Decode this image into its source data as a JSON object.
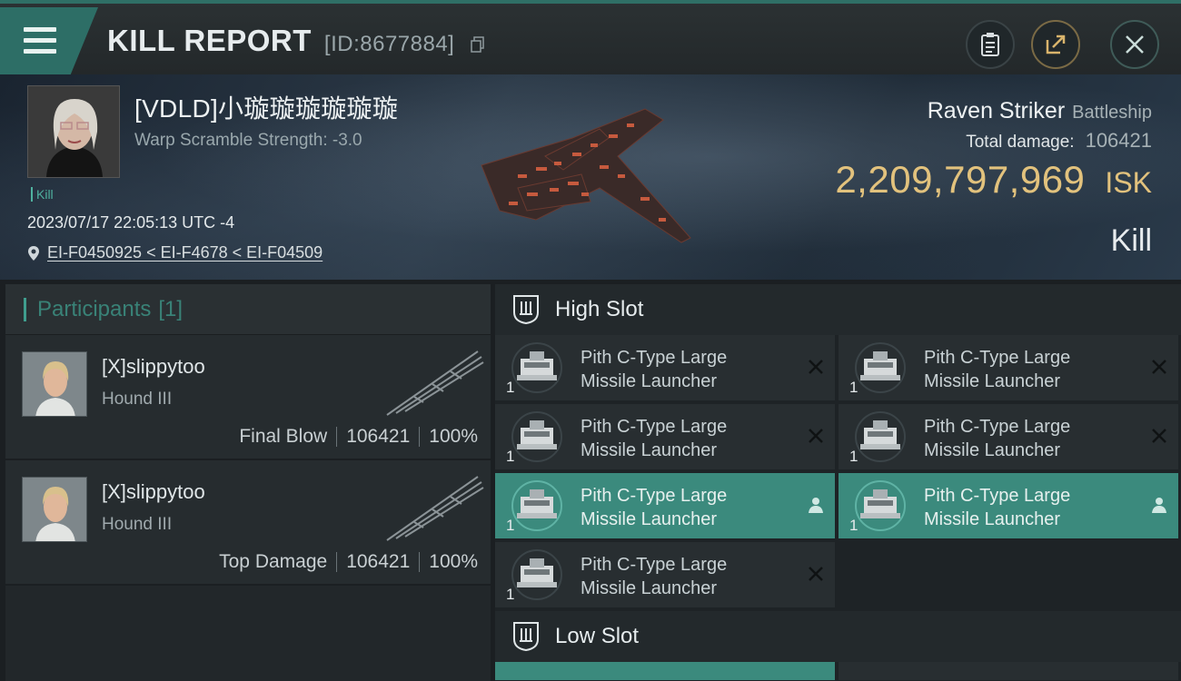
{
  "header": {
    "title": "KILL REPORT",
    "report_id": "[ID:8677884]"
  },
  "victim": {
    "name": "[VDLD]小璇璇璇璇璇璇",
    "warp_scramble": "Warp Scramble Strength: -3.0",
    "tag": "Kill",
    "datetime": "2023/07/17 22:05:13 UTC -4",
    "location": "EI-F0450925 < EI-F4678 < EI-F04509",
    "ship_name": "Raven Striker",
    "ship_class": "Battleship",
    "total_damage_label": "Total damage:",
    "total_damage": "106421",
    "isk_value": "2,209,797,969",
    "isk_unit": "ISK",
    "result": "Kill"
  },
  "participants": {
    "title": "Participants",
    "count": "[1]",
    "rows": [
      {
        "name": "[X]slippytoo",
        "ship": "Hound III",
        "label": "Final Blow",
        "damage": "106421",
        "percent": "100%"
      },
      {
        "name": "[X]slippytoo",
        "ship": "Hound III",
        "label": "Top Damage",
        "damage": "106421",
        "percent": "100%"
      }
    ]
  },
  "slots": {
    "high_title": "High Slot",
    "low_title": "Low Slot",
    "high": [
      {
        "line1": "Pith C-Type Large",
        "line2": "Missile Launcher",
        "qty": "1",
        "state": "destroyed",
        "active": false
      },
      {
        "line1": "Pith C-Type Large",
        "line2": "Missile Launcher",
        "qty": "1",
        "state": "destroyed",
        "active": false
      },
      {
        "line1": "Pith C-Type Large",
        "line2": "Missile Launcher",
        "qty": "1",
        "state": "destroyed",
        "active": false
      },
      {
        "line1": "Pith C-Type Large",
        "line2": "Missile Launcher",
        "qty": "1",
        "state": "destroyed",
        "active": false
      },
      {
        "line1": "Pith C-Type Large",
        "line2": "Missile Launcher",
        "qty": "1",
        "state": "dropped",
        "active": true
      },
      {
        "line1": "Pith C-Type Large",
        "line2": "Missile Launcher",
        "qty": "1",
        "state": "dropped",
        "active": true
      },
      {
        "line1": "Pith C-Type Large",
        "line2": "Missile Launcher",
        "qty": "1",
        "state": "destroyed",
        "active": false
      }
    ]
  },
  "colors": {
    "accent": "#3f9e8e",
    "active_slot": "#3b8a7d",
    "isk": "#e2c27d"
  }
}
